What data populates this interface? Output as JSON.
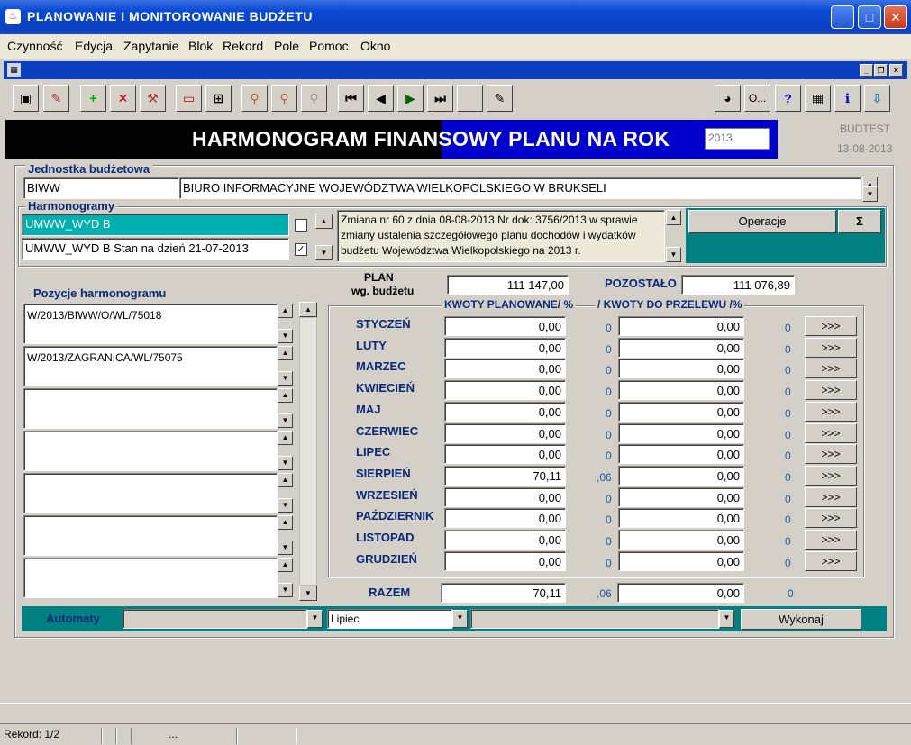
{
  "window": {
    "title": "PLANOWANIE I MONITOROWANIE BUDŻETU",
    "app_icon": "java-coffee-icon"
  },
  "menu": [
    "Czynność",
    "Edycja",
    "Zapytanie",
    "Blok",
    "Rekord",
    "Pole",
    "Pomoc",
    "Okno"
  ],
  "toolbar": {
    "help_label": "?",
    "options_label": "O..."
  },
  "banner": {
    "title": "HARMONOGRAM FINANSOWY PLANU  NA ROK",
    "year": "2013",
    "env": "BUDTEST",
    "date": "13-08-2013"
  },
  "unit": {
    "label": "Jednostka budżetowa",
    "code": "BIWW",
    "name": "BIURO INFORMACYJNE WOJEWÓDZTWA WIELKOPOLSKIEGO W BRUKSELI"
  },
  "schedules": {
    "label": "Harmonogramy",
    "items": [
      {
        "name": "UMWW_WYD B",
        "checked": false
      },
      {
        "name": "UMWW_WYD B Stan na dzień 21-07-2013",
        "checked": true
      }
    ],
    "description": "Zmiana nr 60 z dnia 08-08-2013 Nr dok: 3756/2013 w sprawie zmiany ustalenia szczegółowego planu dochodów i wydatków budżetu Województwa Wielkopolskiego na 2013 r.",
    "operations_label": "Operacje",
    "sum_label": "Σ"
  },
  "positions": {
    "label": "Pozycje harmonogramu",
    "items": [
      "W/2013/BIWW/O/WL/75018",
      "W/2013/ZAGRANICA/WL/75075",
      "",
      "",
      "",
      "",
      ""
    ]
  },
  "plan": {
    "label_line1": "PLAN",
    "label_line2": "wg. budżetu",
    "value": "111 147,00",
    "remaining_label": "POZOSTAŁO",
    "remaining_value": "111 076,89"
  },
  "months_header": {
    "planned": "KWOTY PLANOWANE/ %",
    "transfer": "/ KWOTY DO PRZELEWU /%"
  },
  "months": [
    {
      "name": "STYCZEŃ",
      "planned": "0,00",
      "planned_pct": "0",
      "transfer": "0,00",
      "transfer_pct": "0"
    },
    {
      "name": "LUTY",
      "planned": "0,00",
      "planned_pct": "0",
      "transfer": "0,00",
      "transfer_pct": "0"
    },
    {
      "name": "MARZEC",
      "planned": "0,00",
      "planned_pct": "0",
      "transfer": "0,00",
      "transfer_pct": "0"
    },
    {
      "name": "KWIECIEŃ",
      "planned": "0,00",
      "planned_pct": "0",
      "transfer": "0,00",
      "transfer_pct": "0"
    },
    {
      "name": "MAJ",
      "planned": "0,00",
      "planned_pct": "0",
      "transfer": "0,00",
      "transfer_pct": "0"
    },
    {
      "name": "CZERWIEC",
      "planned": "0,00",
      "planned_pct": "0",
      "transfer": "0,00",
      "transfer_pct": "0"
    },
    {
      "name": "LIPEC",
      "planned": "0,00",
      "planned_pct": "0",
      "transfer": "0,00",
      "transfer_pct": "0"
    },
    {
      "name": "SIERPIEŃ",
      "planned": "70,11",
      "planned_pct": ",06",
      "transfer": "0,00",
      "transfer_pct": "0"
    },
    {
      "name": "WRZESIEŃ",
      "planned": "0,00",
      "planned_pct": "0",
      "transfer": "0,00",
      "transfer_pct": "0"
    },
    {
      "name": "PAŹDZIERNIK",
      "planned": "0,00",
      "planned_pct": "0",
      "transfer": "0,00",
      "transfer_pct": "0"
    },
    {
      "name": "LISTOPAD",
      "planned": "0,00",
      "planned_pct": "0",
      "transfer": "0,00",
      "transfer_pct": "0"
    },
    {
      "name": "GRUDZIEŃ",
      "planned": "0,00",
      "planned_pct": "0",
      "transfer": "0,00",
      "transfer_pct": "0"
    }
  ],
  "transfer_button_label": ">>>",
  "total": {
    "label": "RAZEM",
    "planned": "70,11",
    "planned_pct": ",06",
    "transfer": "0,00",
    "transfer_pct": "0"
  },
  "automaty": {
    "label": "Automaty",
    "select1": "",
    "month": "Lipiec",
    "select3": "",
    "execute_label": "Wykonaj"
  },
  "status": {
    "record": "Rekord: 1/2",
    "extra": "..."
  }
}
